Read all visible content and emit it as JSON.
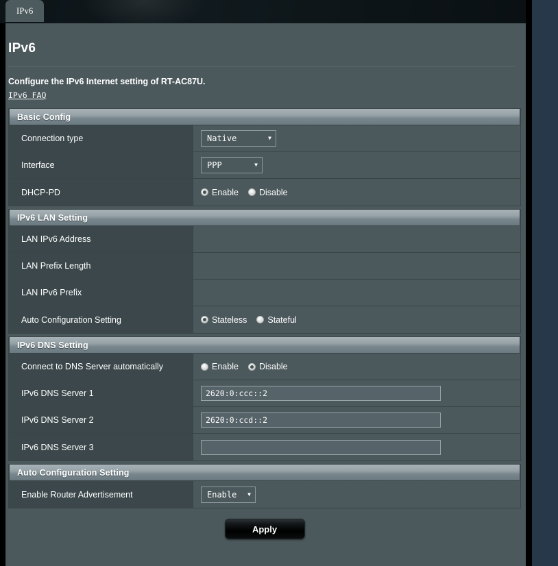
{
  "window": {
    "tab_label": "IPv6"
  },
  "page": {
    "title": "IPv6",
    "description": "Configure the IPv6 Internet setting of RT-AC87U.",
    "faq_link": "IPv6 FAQ"
  },
  "colors": {
    "panel_bg": "#4b585c",
    "label_bg": "#3b474b",
    "section_header_top": "#a8b3b8",
    "section_header_bottom": "#6a7a80",
    "border": "#3a4548",
    "page_bg": "#253746",
    "apply_button": "#000000",
    "text": "#ffffff"
  },
  "sections": [
    {
      "id": "basic-config",
      "header": "Basic Config",
      "rows": [
        {
          "id": "connection-type",
          "label": "Connection type",
          "control": "dropdown",
          "value": "Native",
          "caret": "▼"
        },
        {
          "id": "interface",
          "label": "Interface",
          "control": "dropdown",
          "value": "PPP",
          "caret": "▼"
        },
        {
          "id": "dhcp-pd",
          "label": "DHCP-PD",
          "control": "radio",
          "options": [
            {
              "label": "Enable",
              "checked": true
            },
            {
              "label": "Disable",
              "checked": false
            }
          ]
        }
      ]
    },
    {
      "id": "ipv6-lan-setting",
      "header": "IPv6 LAN Setting",
      "rows": [
        {
          "id": "lan-ipv6-address",
          "label": "LAN IPv6 Address",
          "control": "empty",
          "value": ""
        },
        {
          "id": "lan-prefix-length",
          "label": "LAN Prefix Length",
          "control": "empty",
          "value": ""
        },
        {
          "id": "lan-ipv6-prefix",
          "label": "LAN IPv6 Prefix",
          "control": "empty",
          "value": ""
        },
        {
          "id": "auto-configuration-setting",
          "label": "Auto Configuration Setting",
          "control": "radio",
          "options": [
            {
              "label": "Stateless",
              "checked": true
            },
            {
              "label": "Stateful",
              "checked": false
            }
          ]
        }
      ]
    },
    {
      "id": "ipv6-dns-setting",
      "header": "IPv6 DNS Setting",
      "rows": [
        {
          "id": "connect-dns-automatically",
          "label": "Connect to DNS Server automatically",
          "control": "radio",
          "options": [
            {
              "label": "Enable",
              "checked": false
            },
            {
              "label": "Disable",
              "checked": true
            }
          ]
        },
        {
          "id": "ipv6-dns-server-1",
          "label": "IPv6 DNS Server 1",
          "control": "text",
          "value": "2620:0:ccc::2"
        },
        {
          "id": "ipv6-dns-server-2",
          "label": "IPv6 DNS Server 2",
          "control": "text",
          "value": "2620:0:ccd::2"
        },
        {
          "id": "ipv6-dns-server-3",
          "label": "IPv6 DNS Server 3",
          "control": "text",
          "value": ""
        }
      ]
    },
    {
      "id": "auto-configuration-setting-section",
      "header": "Auto Configuration Setting",
      "rows": [
        {
          "id": "enable-router-advertisement",
          "label": "Enable Router Advertisement",
          "control": "dropdown",
          "value": "Enable",
          "caret": "▼"
        }
      ]
    }
  ],
  "footer": {
    "apply_label": "Apply"
  }
}
